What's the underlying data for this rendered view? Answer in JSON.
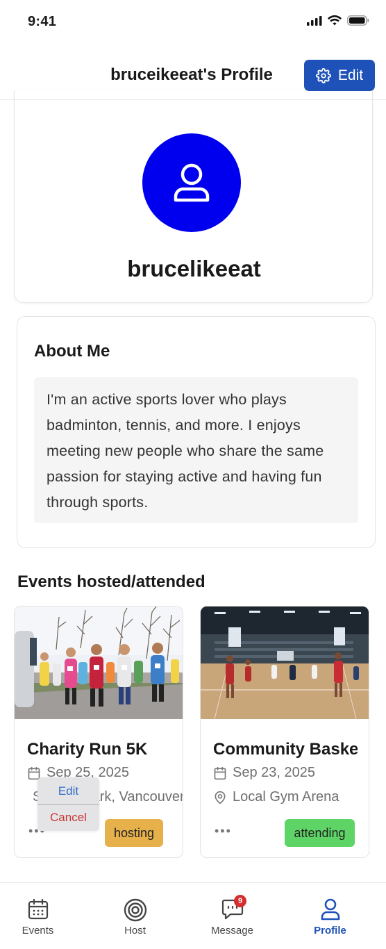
{
  "status_bar": {
    "time": "9:41"
  },
  "header": {
    "title": "bruceikeeat's Profile",
    "edit_label": "Edit"
  },
  "profile": {
    "username": "brucelikeeat"
  },
  "about": {
    "title": "About Me",
    "text": "I'm an active sports lover who plays badminton, tennis, and more. I enjoys meeting new people who share the same passion for staying active and having fun through sports."
  },
  "events": {
    "section_title": "Events hosted/attended",
    "items": [
      {
        "name": "Charity Run 5K",
        "date": "Sep 25, 2025",
        "location": "Stanley Park, Vancouver",
        "badge": "hosting"
      },
      {
        "name": "Community Basketball",
        "date": "Sep 23, 2025",
        "location": "Local Gym Arena",
        "badge": "attending"
      }
    ],
    "more_label": "•••",
    "context_menu": {
      "edit": "Edit",
      "cancel": "Cancel"
    }
  },
  "tab_bar": {
    "tabs": [
      {
        "label": "Events",
        "icon": "calendar-icon"
      },
      {
        "label": "Host",
        "icon": "target-icon"
      },
      {
        "label": "Message",
        "icon": "message-icon"
      },
      {
        "label": "Profile",
        "icon": "person-icon"
      }
    ],
    "active_tab": "Profile",
    "message_badge": "9"
  },
  "colors": {
    "primary": "#1e52b8",
    "avatar_bg": "#0000ee",
    "hosting": "#e6b04a",
    "attending": "#5ed466",
    "badge_red": "#d32f2f"
  }
}
